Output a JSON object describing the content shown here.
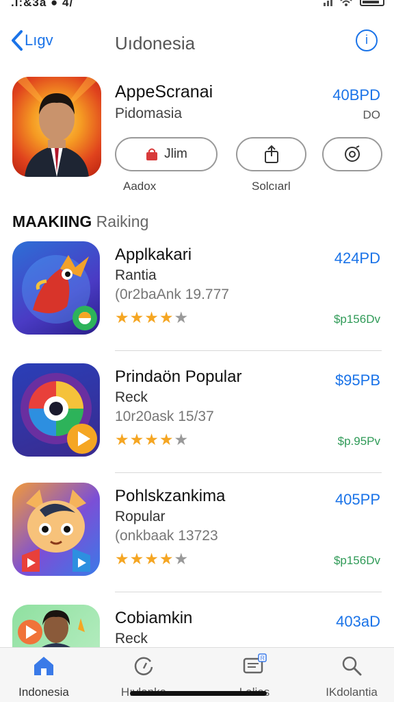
{
  "status": {
    "left_text": ".l:&3a ● 4/",
    "colors": {
      "text": "#222222"
    }
  },
  "nav": {
    "back_label": "Lıgv",
    "title": "Uıdonesia",
    "info_label": "i"
  },
  "featured": {
    "title": "AppeScranai",
    "subtitle": "Pidomasia",
    "price": "40BPD",
    "price_secondary": "DO",
    "buttons": [
      {
        "label": "Jlim",
        "icon": "bag-icon"
      },
      {
        "icon": "share-icon"
      },
      {
        "icon": "gear-icon"
      }
    ],
    "captions": [
      "Aadox",
      "Solcıarl"
    ]
  },
  "section": {
    "bold": "MAAKIING",
    "light": "Raiking"
  },
  "apps": [
    {
      "name": "Applkakari",
      "category": "Rantia",
      "meta": "(0r2baAnk 19.777",
      "rating": 4,
      "price": "424PD",
      "price_secondary": "$p156Dv"
    },
    {
      "name": "Prindaön Popular",
      "category": "Reck",
      "meta": "10r20ask 15/37",
      "rating": 4,
      "price": "$95PB",
      "price_secondary": "$p.95Pv"
    },
    {
      "name": "Pohlskzankima",
      "category": "Ropular",
      "meta": "(onkbaak 13723",
      "rating": 4,
      "price": "405PP",
      "price_secondary": "$p156Dv"
    },
    {
      "name": "Cobiamkin",
      "category": "Reck",
      "meta": "",
      "rating": 0,
      "price": "403aD",
      "price_secondary": ""
    }
  ],
  "tabs": [
    {
      "label": "Indonesia",
      "icon": "home-icon"
    },
    {
      "label": "Hıvlanka",
      "icon": "refresh-icon"
    },
    {
      "label": "Lalies",
      "icon": "screen-icon"
    },
    {
      "label": "IKdolantia",
      "icon": "search-icon"
    }
  ],
  "accent_color": "#1a73e8",
  "star_color": "#f5a623"
}
